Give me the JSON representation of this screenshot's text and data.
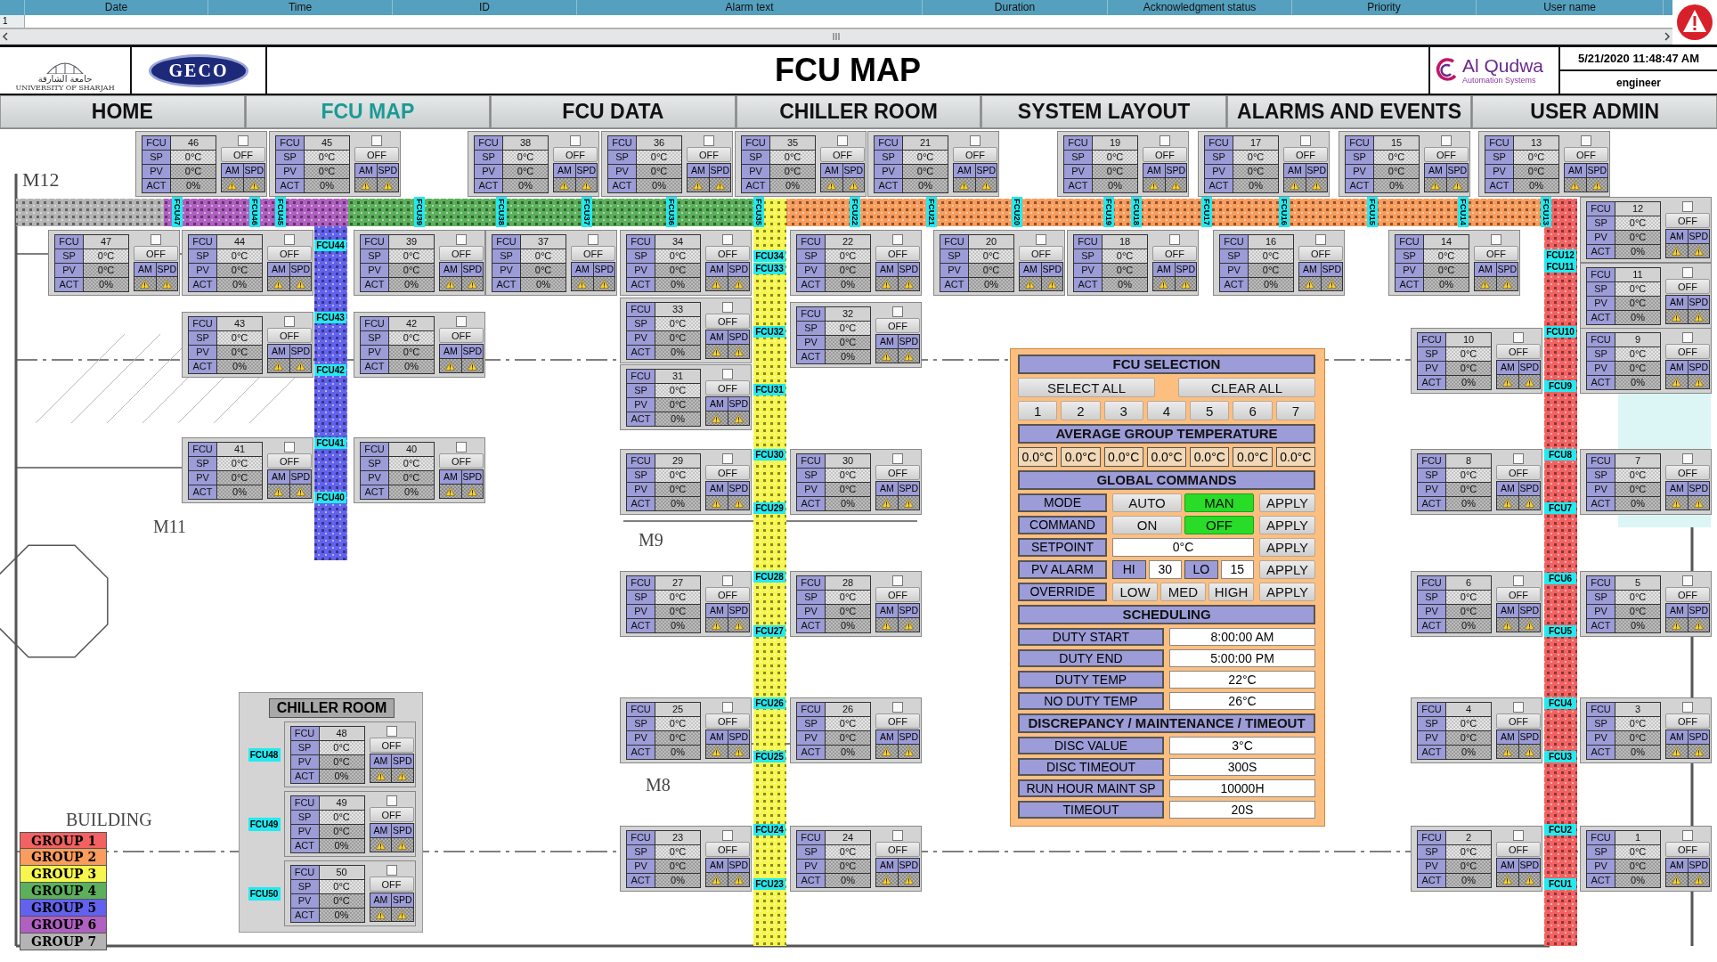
{
  "alarm_table": {
    "columns": [
      "Date",
      "Time",
      "ID",
      "Alarm text",
      "Duration",
      "Acknowledgment status",
      "Priority",
      "User name"
    ],
    "row_numbers": [
      "1"
    ]
  },
  "header": {
    "university": {
      "arabic": "جامعة الشارقة",
      "english": "UNIVERSITY OF SHARJAH"
    },
    "partner_logo": "GECO",
    "title": "FCU MAP",
    "company": {
      "name": "Al Qudwa",
      "tagline": "Automation Systems"
    },
    "datetime": "5/21/2020 11:48:47 AM",
    "user": "engineer"
  },
  "nav": [
    {
      "label": "HOME",
      "selected": false
    },
    {
      "label": "FCU MAP",
      "selected": true
    },
    {
      "label": "FCU DATA",
      "selected": false
    },
    {
      "label": "CHILLER ROOM",
      "selected": false
    },
    {
      "label": "SYSTEM LAYOUT",
      "selected": false
    },
    {
      "label": "ALARMS AND EVENTS",
      "selected": false
    },
    {
      "label": "USER ADMIN",
      "selected": false
    }
  ],
  "map": {
    "room_labels": [
      "M12",
      "M11",
      "M9",
      "M8",
      "BUILDING"
    ],
    "top_duct_tags": [
      "FCU47",
      "FCU46",
      "FCU45",
      "FCU39",
      "FCU38",
      "FCU37",
      "FCU36",
      "FCU35",
      "FCU22",
      "FCU21",
      "FCU20",
      "FCU19",
      "FCU18",
      "FCU17",
      "FCU16",
      "FCU15",
      "FCU14",
      "FCU13"
    ],
    "risers": [
      {
        "tags": [
          "FCU44",
          "FCU43",
          "FCU42",
          "FCU41",
          "FCU40"
        ]
      },
      {
        "tags": [
          "FCU34",
          "FCU33",
          "FCU32",
          "FCU31",
          "FCU30",
          "FCU29",
          "FCU28",
          "FCU27",
          "FCU26",
          "FCU25",
          "FCU24",
          "FCU23"
        ]
      },
      {
        "tags": [
          "FCU12",
          "FCU11",
          "FCU10",
          "FCU9",
          "FCU8",
          "FCU7",
          "FCU6",
          "FCU5",
          "FCU4",
          "FCU3",
          "FCU2",
          "FCU1"
        ]
      }
    ],
    "tiles": [
      {
        "rows": [
          [
            "FCU",
            "46"
          ],
          [
            "SP",
            "0°C"
          ],
          [
            "PV",
            "0°C"
          ],
          [
            "ACT",
            "0%"
          ]
        ],
        "checked": false,
        "status": "OFF",
        "modes": [
          "AM",
          "SPD"
        ],
        "alarm": true
      },
      {
        "rows": [
          [
            "FCU",
            "45"
          ],
          [
            "SP",
            "0°C"
          ],
          [
            "PV",
            "0°C"
          ],
          [
            "ACT",
            "0%"
          ]
        ],
        "checked": false,
        "status": "OFF",
        "modes": [
          "AM",
          "SPD"
        ],
        "alarm": true
      },
      {
        "rows": [
          [
            "FCU",
            "38"
          ],
          [
            "SP",
            "0°C"
          ],
          [
            "PV",
            "0°C"
          ],
          [
            "ACT",
            "0%"
          ]
        ],
        "checked": false,
        "status": "OFF",
        "modes": [
          "AM",
          "SPD"
        ],
        "alarm": true
      },
      {
        "rows": [
          [
            "FCU",
            "36"
          ],
          [
            "SP",
            "0°C"
          ],
          [
            "PV",
            "0°C"
          ],
          [
            "ACT",
            "0%"
          ]
        ],
        "checked": false,
        "status": "OFF",
        "modes": [
          "AM",
          "SPD"
        ],
        "alarm": true
      },
      {
        "rows": [
          [
            "FCU",
            "35"
          ],
          [
            "SP",
            "0°C"
          ],
          [
            "PV",
            "0°C"
          ],
          [
            "ACT",
            "0%"
          ]
        ],
        "checked": false,
        "status": "OFF",
        "modes": [
          "AM",
          "SPD"
        ],
        "alarm": true
      },
      {
        "rows": [
          [
            "FCU",
            "21"
          ],
          [
            "SP",
            "0°C"
          ],
          [
            "PV",
            "0°C"
          ],
          [
            "ACT",
            "0%"
          ]
        ],
        "checked": false,
        "status": "OFF",
        "modes": [
          "AM",
          "SPD"
        ],
        "alarm": true
      },
      {
        "rows": [
          [
            "FCU",
            "19"
          ],
          [
            "SP",
            "0°C"
          ],
          [
            "PV",
            "0°C"
          ],
          [
            "ACT",
            "0%"
          ]
        ],
        "checked": false,
        "status": "OFF",
        "modes": [
          "AM",
          "SPD"
        ],
        "alarm": true
      },
      {
        "rows": [
          [
            "FCU",
            "17"
          ],
          [
            "SP",
            "0°C"
          ],
          [
            "PV",
            "0°C"
          ],
          [
            "ACT",
            "0%"
          ]
        ],
        "checked": false,
        "status": "OFF",
        "modes": [
          "AM",
          "SPD"
        ],
        "alarm": true
      },
      {
        "rows": [
          [
            "FCU",
            "15"
          ],
          [
            "SP",
            "0°C"
          ],
          [
            "PV",
            "0°C"
          ],
          [
            "ACT",
            "0%"
          ]
        ],
        "checked": false,
        "status": "OFF",
        "modes": [
          "AM",
          "SPD"
        ],
        "alarm": true
      },
      {
        "rows": [
          [
            "FCU",
            "13"
          ],
          [
            "SP",
            "0°C"
          ],
          [
            "PV",
            "0°C"
          ],
          [
            "ACT",
            "0%"
          ]
        ],
        "checked": false,
        "status": "OFF",
        "modes": [
          "AM",
          "SPD"
        ],
        "alarm": true
      },
      {
        "rows": [
          [
            "FCU",
            "12"
          ],
          [
            "SP",
            "0°C"
          ],
          [
            "PV",
            "0°C"
          ],
          [
            "ACT",
            "0%"
          ]
        ],
        "checked": false,
        "status": "OFF",
        "modes": [
          "AM",
          "SPD"
        ],
        "alarm": true
      },
      {
        "rows": [
          [
            "FCU",
            "47"
          ],
          [
            "SP",
            "0°C"
          ],
          [
            "PV",
            "0°C"
          ],
          [
            "ACT",
            "0%"
          ]
        ],
        "checked": false,
        "status": "OFF",
        "modes": [
          "AM",
          "SPD"
        ],
        "alarm": true
      },
      {
        "rows": [
          [
            "FCU",
            "44"
          ],
          [
            "SP",
            "0°C"
          ],
          [
            "PV",
            "0°C"
          ],
          [
            "ACT",
            "0%"
          ]
        ],
        "checked": false,
        "status": "OFF",
        "modes": [
          "AM",
          "SPD"
        ],
        "alarm": true
      },
      {
        "rows": [
          [
            "FCU",
            "39"
          ],
          [
            "SP",
            "0°C"
          ],
          [
            "PV",
            "0°C"
          ],
          [
            "ACT",
            "0%"
          ]
        ],
        "checked": false,
        "status": "OFF",
        "modes": [
          "AM",
          "SPD"
        ],
        "alarm": true
      },
      {
        "rows": [
          [
            "FCU",
            "37"
          ],
          [
            "SP",
            "0°C"
          ],
          [
            "PV",
            "0°C"
          ],
          [
            "ACT",
            "0%"
          ]
        ],
        "checked": false,
        "status": "OFF",
        "modes": [
          "AM",
          "SPD"
        ],
        "alarm": true
      },
      {
        "rows": [
          [
            "FCU",
            "34"
          ],
          [
            "SP",
            "0°C"
          ],
          [
            "PV",
            "0°C"
          ],
          [
            "ACT",
            "0%"
          ]
        ],
        "checked": false,
        "status": "OFF",
        "modes": [
          "AM",
          "SPD"
        ],
        "alarm": true
      },
      {
        "rows": [
          [
            "FCU",
            "22"
          ],
          [
            "SP",
            "0°C"
          ],
          [
            "PV",
            "0°C"
          ],
          [
            "ACT",
            "0%"
          ]
        ],
        "checked": false,
        "status": "OFF",
        "modes": [
          "AM",
          "SPD"
        ],
        "alarm": true
      },
      {
        "rows": [
          [
            "FCU",
            "20"
          ],
          [
            "SP",
            "0°C"
          ],
          [
            "PV",
            "0°C"
          ],
          [
            "ACT",
            "0%"
          ]
        ],
        "checked": false,
        "status": "OFF",
        "modes": [
          "AM",
          "SPD"
        ],
        "alarm": true
      },
      {
        "rows": [
          [
            "FCU",
            "18"
          ],
          [
            "SP",
            "0°C"
          ],
          [
            "PV",
            "0°C"
          ],
          [
            "ACT",
            "0%"
          ]
        ],
        "checked": false,
        "status": "OFF",
        "modes": [
          "AM",
          "SPD"
        ],
        "alarm": true
      },
      {
        "rows": [
          [
            "FCU",
            "16"
          ],
          [
            "SP",
            "0°C"
          ],
          [
            "PV",
            "0°C"
          ],
          [
            "ACT",
            "0%"
          ]
        ],
        "checked": false,
        "status": "OFF",
        "modes": [
          "AM",
          "SPD"
        ],
        "alarm": true
      },
      {
        "rows": [
          [
            "FCU",
            "14"
          ],
          [
            "SP",
            "0°C"
          ],
          [
            "PV",
            "0°C"
          ],
          [
            "ACT",
            "0%"
          ]
        ],
        "checked": false,
        "status": "OFF",
        "modes": [
          "AM",
          "SPD"
        ],
        "alarm": true
      },
      {
        "rows": [
          [
            "FCU",
            "11"
          ],
          [
            "SP",
            "0°C"
          ],
          [
            "PV",
            "0°C"
          ],
          [
            "ACT",
            "0%"
          ]
        ],
        "checked": false,
        "status": "OFF",
        "modes": [
          "AM",
          "SPD"
        ],
        "alarm": true
      },
      {
        "rows": [
          [
            "FCU",
            "43"
          ],
          [
            "SP",
            "0°C"
          ],
          [
            "PV",
            "0°C"
          ],
          [
            "ACT",
            "0%"
          ]
        ],
        "checked": false,
        "status": "OFF",
        "modes": [
          "AM",
          "SPD"
        ],
        "alarm": true
      },
      {
        "rows": [
          [
            "FCU",
            "42"
          ],
          [
            "SP",
            "0°C"
          ],
          [
            "PV",
            "0°C"
          ],
          [
            "ACT",
            "0%"
          ]
        ],
        "checked": false,
        "status": "OFF",
        "modes": [
          "AM",
          "SPD"
        ],
        "alarm": true
      },
      {
        "rows": [
          [
            "FCU",
            "33"
          ],
          [
            "SP",
            "0°C"
          ],
          [
            "PV",
            "0°C"
          ],
          [
            "ACT",
            "0%"
          ]
        ],
        "checked": false,
        "status": "OFF",
        "modes": [
          "AM",
          "SPD"
        ],
        "alarm": true
      },
      {
        "rows": [
          [
            "FCU",
            "32"
          ],
          [
            "SP",
            "0°C"
          ],
          [
            "PV",
            "0°C"
          ],
          [
            "ACT",
            "0%"
          ]
        ],
        "checked": false,
        "status": "OFF",
        "modes": [
          "AM",
          "SPD"
        ],
        "alarm": true
      },
      {
        "rows": [
          [
            "FCU",
            "10"
          ],
          [
            "SP",
            "0°C"
          ],
          [
            "PV",
            "0°C"
          ],
          [
            "ACT",
            "0%"
          ]
        ],
        "checked": false,
        "status": "OFF",
        "modes": [
          "AM",
          "SPD"
        ],
        "alarm": true
      },
      {
        "rows": [
          [
            "FCU",
            "9"
          ],
          [
            "SP",
            "0°C"
          ],
          [
            "PV",
            "0°C"
          ],
          [
            "ACT",
            "0%"
          ]
        ],
        "checked": false,
        "status": "OFF",
        "modes": [
          "AM",
          "SPD"
        ],
        "alarm": true
      },
      {
        "rows": [
          [
            "FCU",
            "31"
          ],
          [
            "SP",
            "0°C"
          ],
          [
            "PV",
            "0°C"
          ],
          [
            "ACT",
            "0%"
          ]
        ],
        "checked": false,
        "status": "OFF",
        "modes": [
          "AM",
          "SPD"
        ],
        "alarm": true
      },
      {
        "rows": [
          [
            "FCU",
            "41"
          ],
          [
            "SP",
            "0°C"
          ],
          [
            "PV",
            "0°C"
          ],
          [
            "ACT",
            "0%"
          ]
        ],
        "checked": false,
        "status": "OFF",
        "modes": [
          "AM",
          "SPD"
        ],
        "alarm": true
      },
      {
        "rows": [
          [
            "FCU",
            "40"
          ],
          [
            "SP",
            "0°C"
          ],
          [
            "PV",
            "0°C"
          ],
          [
            "ACT",
            "0%"
          ]
        ],
        "checked": false,
        "status": "OFF",
        "modes": [
          "AM",
          "SPD"
        ],
        "alarm": true
      },
      {
        "rows": [
          [
            "FCU",
            "29"
          ],
          [
            "SP",
            "0°C"
          ],
          [
            "PV",
            "0°C"
          ],
          [
            "ACT",
            "0%"
          ]
        ],
        "checked": false,
        "status": "OFF",
        "modes": [
          "AM",
          "SPD"
        ],
        "alarm": true
      },
      {
        "rows": [
          [
            "FCU",
            "30"
          ],
          [
            "SP",
            "0°C"
          ],
          [
            "PV",
            "0°C"
          ],
          [
            "ACT",
            "0%"
          ]
        ],
        "checked": false,
        "status": "OFF",
        "modes": [
          "AM",
          "SPD"
        ],
        "alarm": true
      },
      {
        "rows": [
          [
            "FCU",
            "8"
          ],
          [
            "SP",
            "0°C"
          ],
          [
            "PV",
            "0°C"
          ],
          [
            "ACT",
            "0%"
          ]
        ],
        "checked": false,
        "status": "OFF",
        "modes": [
          "AM",
          "SPD"
        ],
        "alarm": true
      },
      {
        "rows": [
          [
            "FCU",
            "7"
          ],
          [
            "SP",
            "0°C"
          ],
          [
            "PV",
            "0°C"
          ],
          [
            "ACT",
            "0%"
          ]
        ],
        "checked": false,
        "status": "OFF",
        "modes": [
          "AM",
          "SPD"
        ],
        "alarm": true
      },
      {
        "rows": [
          [
            "FCU",
            "27"
          ],
          [
            "SP",
            "0°C"
          ],
          [
            "PV",
            "0°C"
          ],
          [
            "ACT",
            "0%"
          ]
        ],
        "checked": false,
        "status": "OFF",
        "modes": [
          "AM",
          "SPD"
        ],
        "alarm": true
      },
      {
        "rows": [
          [
            "FCU",
            "28"
          ],
          [
            "SP",
            "0°C"
          ],
          [
            "PV",
            "0°C"
          ],
          [
            "ACT",
            "0%"
          ]
        ],
        "checked": false,
        "status": "OFF",
        "modes": [
          "AM",
          "SPD"
        ],
        "alarm": true
      },
      {
        "rows": [
          [
            "FCU",
            "6"
          ],
          [
            "SP",
            "0°C"
          ],
          [
            "PV",
            "0°C"
          ],
          [
            "ACT",
            "0%"
          ]
        ],
        "checked": false,
        "status": "OFF",
        "modes": [
          "AM",
          "SPD"
        ],
        "alarm": true
      },
      {
        "rows": [
          [
            "FCU",
            "5"
          ],
          [
            "SP",
            "0°C"
          ],
          [
            "PV",
            "0°C"
          ],
          [
            "ACT",
            "0%"
          ]
        ],
        "checked": false,
        "status": "OFF",
        "modes": [
          "AM",
          "SPD"
        ],
        "alarm": true
      },
      {
        "rows": [
          [
            "FCU",
            "25"
          ],
          [
            "SP",
            "0°C"
          ],
          [
            "PV",
            "0°C"
          ],
          [
            "ACT",
            "0%"
          ]
        ],
        "checked": false,
        "status": "OFF",
        "modes": [
          "AM",
          "SPD"
        ],
        "alarm": true
      },
      {
        "rows": [
          [
            "FCU",
            "26"
          ],
          [
            "SP",
            "0°C"
          ],
          [
            "PV",
            "0°C"
          ],
          [
            "ACT",
            "0%"
          ]
        ],
        "checked": false,
        "status": "OFF",
        "modes": [
          "AM",
          "SPD"
        ],
        "alarm": true
      },
      {
        "rows": [
          [
            "FCU",
            "4"
          ],
          [
            "SP",
            "0°C"
          ],
          [
            "PV",
            "0°C"
          ],
          [
            "ACT",
            "0%"
          ]
        ],
        "checked": false,
        "status": "OFF",
        "modes": [
          "AM",
          "SPD"
        ],
        "alarm": true
      },
      {
        "rows": [
          [
            "FCU",
            "3"
          ],
          [
            "SP",
            "0°C"
          ],
          [
            "PV",
            "0°C"
          ],
          [
            "ACT",
            "0%"
          ]
        ],
        "checked": false,
        "status": "OFF",
        "modes": [
          "AM",
          "SPD"
        ],
        "alarm": true
      },
      {
        "rows": [
          [
            "FCU",
            "23"
          ],
          [
            "SP",
            "0°C"
          ],
          [
            "PV",
            "0°C"
          ],
          [
            "ACT",
            "0%"
          ]
        ],
        "checked": false,
        "status": "OFF",
        "modes": [
          "AM",
          "SPD"
        ],
        "alarm": true
      },
      {
        "rows": [
          [
            "FCU",
            "24"
          ],
          [
            "SP",
            "0°C"
          ],
          [
            "PV",
            "0°C"
          ],
          [
            "ACT",
            "0%"
          ]
        ],
        "checked": false,
        "status": "OFF",
        "modes": [
          "AM",
          "SPD"
        ],
        "alarm": true
      },
      {
        "rows": [
          [
            "FCU",
            "2"
          ],
          [
            "SP",
            "0°C"
          ],
          [
            "PV",
            "0°C"
          ],
          [
            "ACT",
            "0%"
          ]
        ],
        "checked": false,
        "status": "OFF",
        "modes": [
          "AM",
          "SPD"
        ],
        "alarm": true
      },
      {
        "rows": [
          [
            "FCU",
            "1"
          ],
          [
            "SP",
            "0°C"
          ],
          [
            "PV",
            "0°C"
          ],
          [
            "ACT",
            "0%"
          ]
        ],
        "checked": false,
        "status": "OFF",
        "modes": [
          "AM",
          "SPD"
        ],
        "alarm": true
      }
    ],
    "chiller_room": {
      "title": "CHILLER ROOM",
      "units": [
        {
          "tag": "FCU48",
          "rows": [
            [
              "FCU",
              "48"
            ],
            [
              "SP",
              "0°C"
            ],
            [
              "PV",
              "0°C"
            ],
            [
              "ACT",
              "0%"
            ]
          ],
          "checked": false,
          "status": "OFF",
          "modes": [
            "AM",
            "SPD"
          ],
          "alarm": true
        },
        {
          "tag": "FCU49",
          "rows": [
            [
              "FCU",
              "49"
            ],
            [
              "SP",
              "0°C"
            ],
            [
              "PV",
              "0°C"
            ],
            [
              "ACT",
              "0%"
            ]
          ],
          "checked": false,
          "status": "OFF",
          "modes": [
            "AM",
            "SPD"
          ],
          "alarm": true
        },
        {
          "tag": "FCU50",
          "rows": [
            [
              "FCU",
              "50"
            ],
            [
              "SP",
              "0°C"
            ],
            [
              "PV",
              "0°C"
            ],
            [
              "ACT",
              "0%"
            ]
          ],
          "checked": false,
          "status": "OFF",
          "modes": [
            "AM",
            "SPD"
          ],
          "alarm": true
        }
      ]
    },
    "legend": [
      {
        "label": "GROUP 1",
        "color": "#f26262"
      },
      {
        "label": "GROUP 2",
        "color": "#fa9c5c"
      },
      {
        "label": "GROUP 3",
        "color": "#f6f64e"
      },
      {
        "label": "GROUP 4",
        "color": "#5cb05c"
      },
      {
        "label": "GROUP 5",
        "color": "#6262ee"
      },
      {
        "label": "GROUP 6",
        "color": "#b060c0"
      },
      {
        "label": "GROUP 7",
        "color": "#b4b4b4"
      }
    ]
  },
  "fcu_selection": {
    "title": "FCU SELECTION",
    "actions": [
      "SELECT ALL",
      "CLEAR ALL"
    ],
    "groups": [
      "1",
      "2",
      "3",
      "4",
      "5",
      "6",
      "7"
    ],
    "average": {
      "title": "AVERAGE GROUP TEMPERATURE",
      "values": [
        "0.0°C",
        "0.0°C",
        "0.0°C",
        "0.0°C",
        "0.0°C",
        "0.0°C",
        "0.0°C"
      ]
    },
    "global_commands": {
      "title": "GLOBAL COMMANDS",
      "rows": [
        {
          "kind": "choice",
          "label": "MODE",
          "options": [
            {
              "label": "AUTO",
              "selected": false
            },
            {
              "label": "MAN",
              "selected": true
            }
          ],
          "apply": "APPLY"
        },
        {
          "kind": "choice",
          "label": "COMMAND",
          "options": [
            {
              "label": "ON",
              "selected": false
            },
            {
              "label": "OFF",
              "selected": true
            }
          ],
          "apply": "APPLY"
        },
        {
          "kind": "field",
          "label": "SETPOINT",
          "value": "0°C",
          "apply": "APPLY"
        },
        {
          "kind": "alarm",
          "label": "PV ALARM",
          "hi": "HI",
          "hi_value": "30",
          "lo": "LO",
          "lo_value": "15",
          "apply": "APPLY"
        },
        {
          "kind": "choice",
          "label": "OVERRIDE",
          "options": [
            {
              "label": "LOW",
              "selected": false
            },
            {
              "label": "MED",
              "selected": false
            },
            {
              "label": "HIGH",
              "selected": false
            }
          ],
          "apply": "APPLY"
        }
      ]
    },
    "sections": [
      {
        "title": "SCHEDULING",
        "rows": [
          {
            "label": "DUTY START",
            "value": "8:00:00 AM"
          },
          {
            "label": "DUTY END",
            "value": "5:00:00 PM"
          },
          {
            "label": "DUTY TEMP",
            "value": "22°C"
          },
          {
            "label": "NO DUTY TEMP",
            "value": "26°C"
          }
        ]
      },
      {
        "title": "DISCREPANCY / MAINTENANCE / TIMEOUT",
        "rows": [
          {
            "label": "DISC VALUE",
            "value": "3°C"
          },
          {
            "label": "DISC TIMEOUT",
            "value": "300S"
          },
          {
            "label": "RUN HOUR MAINT SP",
            "value": "10000H"
          },
          {
            "label": "TIMEOUT",
            "value": "20S"
          }
        ]
      }
    ]
  }
}
